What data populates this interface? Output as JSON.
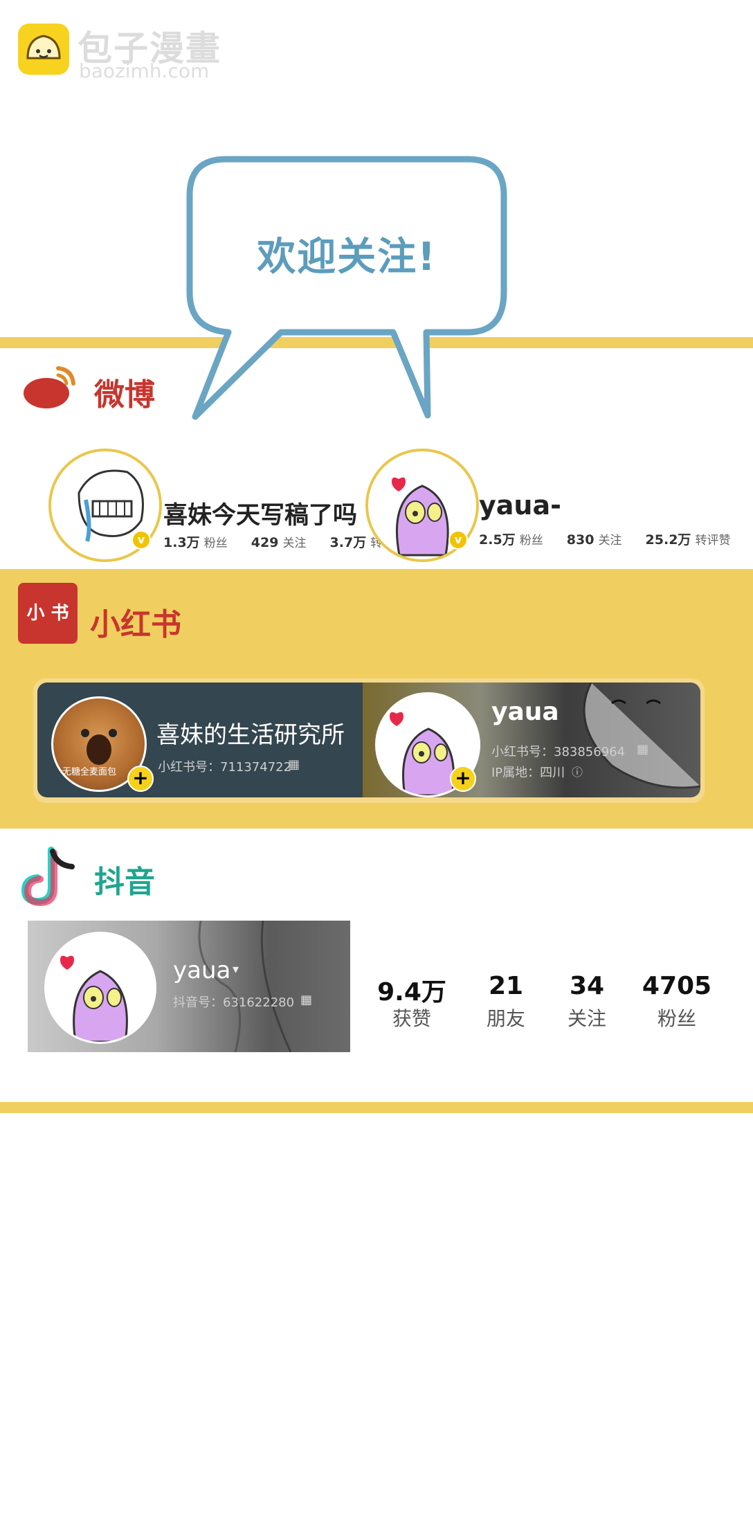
{
  "watermark": {
    "title": "包子漫畫",
    "url": "baozimh.com"
  },
  "bubble": {
    "text": "欢迎关注!"
  },
  "weibo": {
    "title": "微博",
    "accounts": [
      {
        "name": "喜妹今天写稿了吗",
        "stats": [
          {
            "num": "1.3万",
            "label": "粉丝"
          },
          {
            "num": "429",
            "label": "关注"
          },
          {
            "num": "3.7万",
            "label": "转评赞"
          }
        ]
      },
      {
        "name": "yaua-",
        "stats": [
          {
            "num": "2.5万",
            "label": "粉丝"
          },
          {
            "num": "830",
            "label": "关注"
          },
          {
            "num": "25.2万",
            "label": "转评赞"
          }
        ]
      }
    ]
  },
  "xiaohongshu": {
    "title": "小红书",
    "logo_text": "小 书",
    "accounts": [
      {
        "name": "喜妹的生活研究所",
        "id_line": "小红书号：711374722",
        "avatar_caption": "无糖全麦面包"
      },
      {
        "name": "yaua",
        "id_line": "小红书号：383856964",
        "ip_line": "IP属地：四川"
      }
    ]
  },
  "douyin": {
    "title": "抖音",
    "account": {
      "name": "yaua",
      "id_line": "抖音号：631622280"
    },
    "stats": [
      {
        "num": "9.4万",
        "label": "获赞"
      },
      {
        "num": "21",
        "label": "朋友"
      },
      {
        "num": "34",
        "label": "关注"
      },
      {
        "num": "4705",
        "label": "粉丝"
      }
    ]
  },
  "colors": {
    "band": "#f0cf60",
    "bubble_stroke": "#6aa5c4",
    "weibo_red": "#c8352e",
    "douyin_teal": "#1fa58f"
  }
}
